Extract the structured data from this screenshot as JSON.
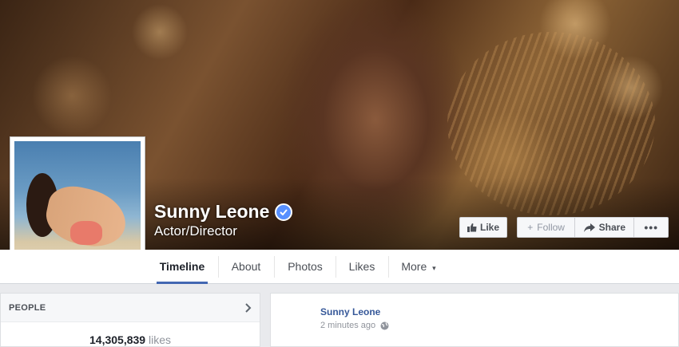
{
  "page": {
    "name": "Sunny Leone",
    "category": "Actor/Director",
    "verified": true
  },
  "actions": {
    "like_label": "Like",
    "follow_label": "Follow",
    "share_label": "Share",
    "more_label": "•••"
  },
  "tabs": [
    {
      "label": "Timeline",
      "active": true
    },
    {
      "label": "About"
    },
    {
      "label": "Photos"
    },
    {
      "label": "Likes"
    },
    {
      "label": "More",
      "caret": "▾"
    }
  ],
  "people": {
    "title": "PEOPLE",
    "likes_count": "14,305,839",
    "likes_label": "likes"
  },
  "post": {
    "author": "Sunny Leone",
    "timestamp": "2 minutes ago"
  },
  "colors": {
    "accent": "#4267b2",
    "link": "#365899",
    "verified": "#5890ff"
  },
  "icons": [
    "verified-badge-icon",
    "thumbs-up-icon",
    "plus-icon",
    "share-arrow-icon",
    "chevron-right-icon",
    "globe-icon",
    "caret-down-icon"
  ]
}
